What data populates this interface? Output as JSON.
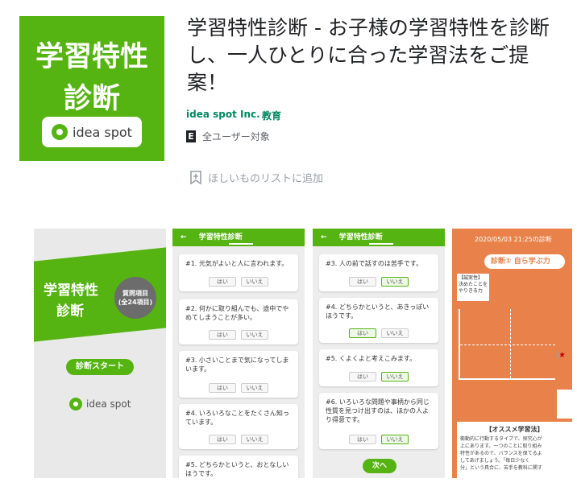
{
  "app": {
    "icon_line1": "学習特性",
    "icon_line2": "診断",
    "icon_brand": "idea spot",
    "title": "学習特性診断 - お子様の学習特性を診断し、一人ひとりに合った学習法をご提案！",
    "developer": "idea spot Inc.",
    "category": "教育",
    "rating_badge": "E",
    "rating_text": "全ユーザー対象",
    "wishlist_label": "ほしいものリストに追加",
    "accent_color": "#55b411",
    "link_color": "#01875f"
  },
  "shots": {
    "s1": {
      "title_line1": "学習特性",
      "title_line2": "診断",
      "badge_line1": "質問項目",
      "badge_line2": "(全24項目)",
      "start_button": "診断スタート",
      "brand": "idea spot"
    },
    "s2": {
      "header": "学習特性診断",
      "questions": [
        "#1. 元気がよいと人に言われます。",
        "#2. 何かに取り組んでも、途中でやめてしまうことが多い。",
        "#3. 小さいことまで気になってしまいます。",
        "#4. いろいろなことをたくさん知っています。",
        "#5. どちらかというと、おとなしいほうです。"
      ]
    },
    "s3": {
      "header": "学習特性診断",
      "questions": [
        "#3. 人の前で話すのは苦手です。",
        "#4. どちらかというと、あきっぽいほうです。",
        "#5. くよくよと考えこみます。",
        "#6. いろいろな問題や事柄から同じ性質を見つけ出すのは、ほかの人より得意です。"
      ],
      "next_button": "次へ"
    },
    "answer_yes": "はい",
    "answer_no": "いいえ",
    "s4": {
      "date": "2020/05/03 21:25の診断",
      "pill": "診断① 自ら学ぶ力",
      "label_box": "【誠実性】\n決めたことを\nやりきる力",
      "rec_title": "【オススメ学習法】",
      "rec_text": "衝動的に行動するタイプで、探究心が\n上にあります。一つのことに取り組み\n特性があるので、バランスを保てるよ\nしてあげましょう。「毎日少なく\n分」という具合に、苦手を教科に関す"
    }
  },
  "icons": {
    "wishlist": "bookmark-plus-icon",
    "next": "chevron-right-icon",
    "back": "arrow-left-icon"
  }
}
